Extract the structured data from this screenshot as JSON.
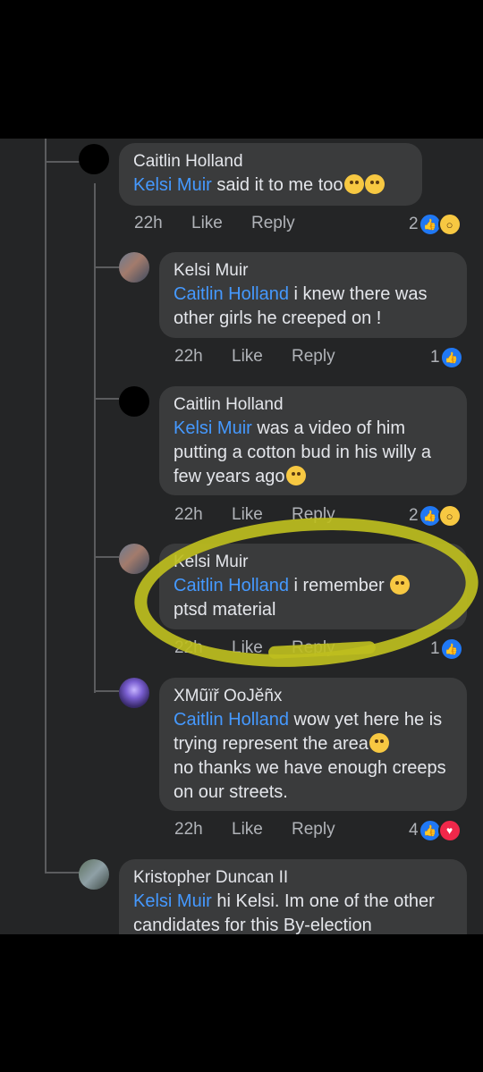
{
  "colors": {
    "background": "#242526",
    "bubble": "#3a3b3c",
    "mention": "#4599ff",
    "meta": "#b0b3b8",
    "highlight": "#bebe1e"
  },
  "comments": [
    {
      "author": "Caitlin Holland",
      "mention": "Kelsi Muir",
      "text": " said it to me too",
      "emojis": [
        "loudly-crying-face",
        "loudly-crying-face"
      ],
      "time": "22h",
      "like": "Like",
      "reply": "Reply",
      "reaction_count": "2",
      "reactions": [
        "like-icon",
        "wow-icon"
      ]
    },
    {
      "author": "Kelsi Muir",
      "mention": "Caitlin Holland",
      "text": " i knew there was other girls he creeped on !",
      "emojis": [],
      "time": "22h",
      "like": "Like",
      "reply": "Reply",
      "reaction_count": "1",
      "reactions": [
        "like-icon"
      ]
    },
    {
      "author": "Caitlin Holland",
      "mention": "Kelsi Muir",
      "text": " was a video of him putting a cotton bud in his willy a few years ago",
      "emojis": [
        "loudly-crying-face"
      ],
      "time": "22h",
      "like": "Like",
      "reply": "Reply",
      "reaction_count": "2",
      "reactions": [
        "like-icon",
        "wow-icon"
      ]
    },
    {
      "author": "Kelsi Muir",
      "mention": "Caitlin Holland",
      "text": " i remember ",
      "text2": "ptsd material",
      "emojis": [
        "tears-of-joy-face"
      ],
      "time": "22h",
      "like": "Like",
      "reply": "Reply",
      "reaction_count": "1",
      "reactions": [
        "like-icon"
      ]
    },
    {
      "author": "XMũïř OoJĕñx",
      "mention": "Caitlin Holland",
      "text": " wow yet here he is trying represent the area",
      "text2": "no thanks we have enough creeps on our streets.",
      "emojis": [
        "flushed-face"
      ],
      "time": "22h",
      "like": "Like",
      "reply": "Reply",
      "reaction_count": "4",
      "reactions": [
        "like-icon",
        "love-icon"
      ]
    },
    {
      "author": "Kristopher Duncan II",
      "mention": "Kelsi Muir",
      "text": " hi Kelsi. Im one of the other candidates for this By-election"
    }
  ]
}
